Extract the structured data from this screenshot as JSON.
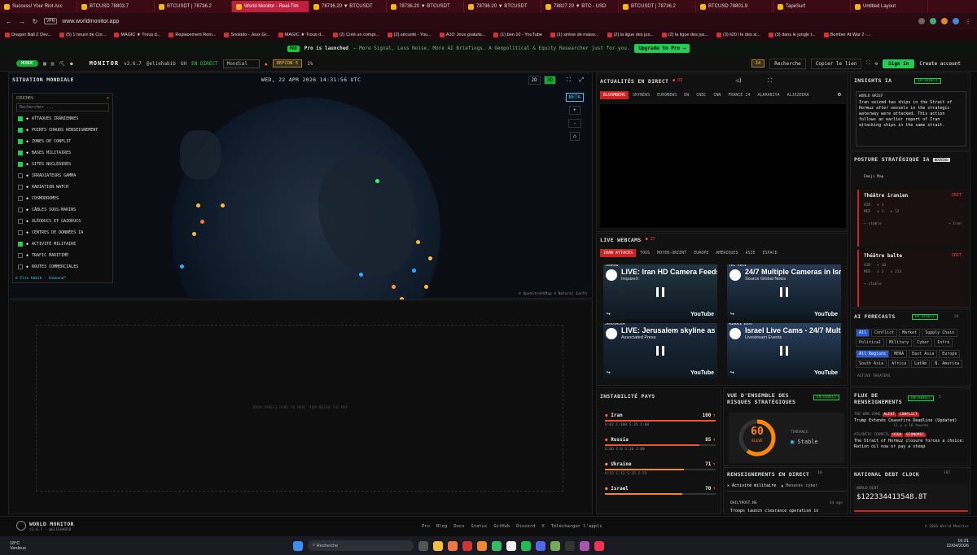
{
  "browser": {
    "tabs": [
      {
        "label": "Success! Your Riot Acc",
        "active": false
      },
      {
        "label": "BTCUSD 78803.7",
        "active": false
      },
      {
        "label": "BTCUSDT | 78736.2",
        "active": false
      },
      {
        "label": "World Monitor - Real-Tim",
        "active": true
      },
      {
        "label": "78736.20 ▼ BTCUSDT",
        "active": false
      },
      {
        "label": "78736.20 ▼ BTCUSDT",
        "active": false
      },
      {
        "label": "78736.20 ▼ BTCUSDT",
        "active": false
      },
      {
        "label": "78827.20 ▼ BTC - USD",
        "active": false
      },
      {
        "label": "BTCUSDT | 78736.2",
        "active": false
      },
      {
        "label": "BTCUSD 78801.9",
        "active": false
      },
      {
        "label": "TapeSurf",
        "active": false
      },
      {
        "label": "Untitled Layout",
        "active": false
      }
    ],
    "vpn": "VPN",
    "url": "www.worldmonitor.app",
    "bookmarks": [
      "Dragon Ball Z Dev...",
      "(5) 1 heure de Cor...",
      "MAGIC ★ Trous d...",
      "Replacement Rem...",
      "Snokido - Jeux Gr...",
      "MAGIC ★ Trous d...",
      "(2) Créé un compt...",
      "(2) sécurité - You...",
      "A10: Jeux gratuits...",
      "(1) ben 10 - YouTube",
      "(1) sirène de maiso...",
      "(2) la ligue des jus...",
      "(2) la ligue des jus...",
      "(3) li20 i le des si...",
      "(3) dans le jungle t...",
      "Bomber At War 2 -..."
    ]
  },
  "promo": {
    "pro": "PRO",
    "title": "Pro is launched",
    "text": "— More Signal, Less Noise. More AI Briefings. A Geopolitical & Equity Researcher just for you.",
    "cta": "Upgrade to Pro →"
  },
  "appbar": {
    "mode": "MONDE",
    "logo": "MONITOR",
    "version": "v2.6.7",
    "handle": "@eliehabib",
    "github": "GH",
    "live": "EN DIRECT",
    "region": "Mondial",
    "defcon": "DEFCON 5",
    "defcon_pct": "1%",
    "alerts": "24",
    "search": "Recherche",
    "copy_link": "Copier le lien",
    "signin": "Sign in",
    "create": "Create account"
  },
  "map": {
    "title": "SITUATION MONDIALE",
    "datetime": "WED, 22 APR 2026 14:31:56 UTC",
    "view2d": "2D",
    "view3d": "3D",
    "beta": "BETA",
    "zoom_in": "+",
    "zoom_out": "-",
    "home": "⌂",
    "attribution": "© OpenStreetMap © Natural Earth",
    "layers_title": "COUCHES",
    "search_placeholder": "Rechercher ...",
    "footer": "© Elie Habib · Someone™",
    "layers": [
      {
        "label": "ATTAQUES IRANIENNES",
        "on": true
      },
      {
        "label": "POINTS CHAUDS RENSEIGNEMENT",
        "on": true
      },
      {
        "label": "ZONES DE CONFLIT",
        "on": true
      },
      {
        "label": "BASES MILITAIRES",
        "on": true
      },
      {
        "label": "SITES NUCLÉAIRES",
        "on": true
      },
      {
        "label": "IRRADIATEURS GAMMA",
        "on": false
      },
      {
        "label": "RADIATION WATCH",
        "on": false
      },
      {
        "label": "COSMODROMES",
        "on": false
      },
      {
        "label": "CÂBLES SOUS-MARINS",
        "on": false
      },
      {
        "label": "OLÉODUCS ET GAZODUCS",
        "on": false
      },
      {
        "label": "CENTRES DE DONNÉES IA",
        "on": false
      },
      {
        "label": "ACTIVITÉ MILITAIRE",
        "on": true
      },
      {
        "label": "TRAFIC MARITIME",
        "on": false
      },
      {
        "label": "ROUTES COMMERCIALES",
        "on": false
      }
    ],
    "drop_text": "DROP PANELS HERE TO MOVE THEM BELOW THE MAP"
  },
  "news_live": {
    "title": "ACTUALITÉS EN DIRECT",
    "live": "● DI",
    "channels": [
      "BLOOMBERG",
      "SKYNEWS",
      "EURONEWS",
      "DW",
      "CNBC",
      "CNN",
      "FRANCE 24",
      "ALARABIYA",
      "ALJAZEERA"
    ]
  },
  "webcams": {
    "title": "LIVE WEBCAMS",
    "live": "● 27",
    "filters": [
      "IRAN ATTACKS",
      "TOUS",
      "MOYEN-ORIENT",
      "EUROPE",
      "AMÉRIQUES",
      "ASIE",
      "ESPACE"
    ],
    "videos": [
      {
        "tag": "TEHRAN",
        "title": "LIVE: Iran HD Camera Feeds f",
        "sub": "InquizeX",
        "brand": "YouTube"
      },
      {
        "tag": "TEL AVIV",
        "title": "24/7 Multiple Cameras in Isra",
        "sub": "Source Global News",
        "brand": "YouTube"
      },
      {
        "tag": "JERUSALEM",
        "title": "LIVE: Jerusalem skyline as Ira",
        "sub": "Associated Press",
        "brand": "YouTube"
      },
      {
        "tag": "MIDDLE EAST",
        "title": "Israel Live Cams - 24/7 Multic",
        "sub": "Livestream Events",
        "brand": "YouTube"
      }
    ]
  },
  "insights": {
    "title": "INSIGHTS IA",
    "badge": "EN DIRECT",
    "brief_label": "WORLD BRIEF",
    "brief": "Iran seized two ships in the Strait of Hormuz after vessels in the strategic waterway were attacked. This action follows an earlier report of Iran attacking ships in the same strait."
  },
  "posture": {
    "title": "POSTURE STRATÉGIQUE IA",
    "badge": "NOUVEAU",
    "theaters_hint": "Emoji Map",
    "theaters": [
      {
        "name": "Théâtre iranien",
        "level": "CRIT",
        "air": "3",
        "sea": "1",
        "land": "12",
        "trend": "stable",
        "target": "→ Iran"
      },
      {
        "name": "Théâtre balte",
        "level": "CRIT",
        "air": "10",
        "sea": "3",
        "land": "213",
        "trend": "stable",
        "target": ""
      }
    ]
  },
  "forecasts": {
    "title": "AI FORECASTS",
    "badge": "EN DIRECT",
    "count": "24",
    "topics": [
      "All",
      "Conflict",
      "Market",
      "Supply Chain",
      "Political",
      "Military",
      "Cyber",
      "Infra"
    ],
    "regions": [
      "All Regions",
      "MENA",
      "East Asia",
      "Europe",
      "South Asia",
      "Africa",
      "LatAm",
      "N. America"
    ],
    "footer": "ACTIVE THEATERS"
  },
  "instability": {
    "title": "INSTABILITÉ PAYS",
    "countries": [
      {
        "name": "Iran",
        "score": "100",
        "trend": "↑",
        "detail": "U:82  C:100  S:35  I:80",
        "pct": 100,
        "color": "#e53"
      },
      {
        "name": "Russia",
        "score": "85",
        "trend": "↑",
        "detail": "U:66  C:0  S:38  I:80",
        "pct": 85,
        "color": "#e53"
      },
      {
        "name": "Ukraine",
        "score": "71",
        "trend": "↑",
        "detail": "U:15  C:12  S:35  I:55",
        "pct": 71,
        "color": "#e83"
      },
      {
        "name": "Israel",
        "score": "70",
        "trend": "↑",
        "detail": "",
        "pct": 70,
        "color": "#e83"
      }
    ]
  },
  "risk": {
    "title": "VUE D'ENSEMBLE DES RISQUES STRATÉGIQUES",
    "badge": "EN DIRECT",
    "score": "60",
    "level": "ÉLEVÉ",
    "score_pct": 60,
    "trend_label": "TENDANCE",
    "trend": "Stable"
  },
  "feed": {
    "title": "FLUX DE RENSEIGNEMENTS",
    "badge": "EN DIRECT",
    "count": "5",
    "items": [
      {
        "source": "THE WAR ZONE",
        "tags": [
          "ALERT",
          "CONFLICT"
        ],
        "headline": "Trump Extends Ceasefire Deadline (Updated)",
        "time": "il y a 16 heures"
      },
      {
        "source": "ATLANTIC COUNCIL",
        "tags": [
          "HIGH",
          "ECONOMIC"
        ],
        "headline": "The Strait of Hormuz closure forces a choice: Ration oil now or pay a steep",
        "time": ""
      }
    ]
  },
  "intel": {
    "title": "RENSEIGNEMENTS EN DIRECT",
    "count": "10",
    "tabs": [
      "Activité militaire",
      "Menaces cyber"
    ],
    "source": "DAILYPOST.NG",
    "age": "3d ago",
    "headline": "Troops launch clearance operation in"
  },
  "debt": {
    "title": "NATIONAL DEBT CLOCK",
    "count": "197",
    "label": "WORLD DEBT",
    "value": "$122334413548.8T"
  },
  "footer": {
    "title": "WORLD MONITOR",
    "version": "v2.6.7 · @ELIEHABIB",
    "links": [
      "Pro",
      "Blog",
      "Docs",
      "Status",
      "GitHub",
      "Discord",
      "X",
      "Télécharger l'appli"
    ],
    "copyright": "© 2026 World Monitor"
  },
  "taskbar": {
    "temp": "18°C",
    "weather": "Venteux",
    "search": "Recherche",
    "time": "16:31",
    "date": "22/04/2026"
  },
  "colors": {
    "accent": "#22cc55",
    "alert": "#cc2222",
    "warn": "#ff8800"
  }
}
